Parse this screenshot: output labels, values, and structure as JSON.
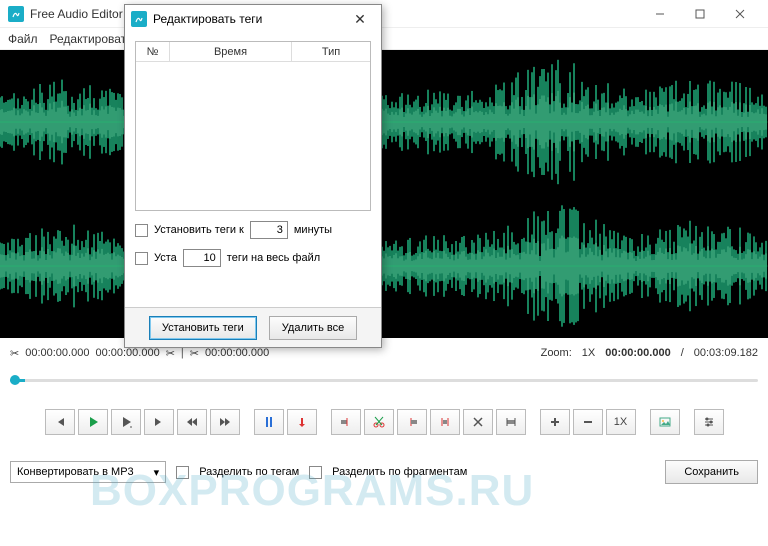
{
  "title": "Free Audio Editor",
  "menu": {
    "file": "Файл",
    "edit": "Редактировать"
  },
  "timeline": {
    "t1": "00:00:00.000",
    "t2": "00:00:00.000",
    "t3": "00:00:00.000",
    "zoom_label": "Zoom:",
    "zoom_val": "1X",
    "pos": "00:00:00.000",
    "dur": "00:03:09.182"
  },
  "toolbar": {
    "rate": "1X"
  },
  "bottom": {
    "convert": "Конвертировать в MP3",
    "split_tags": "Разделить по тегам",
    "split_frag": "Разделить по фрагментам",
    "save": "Сохранить"
  },
  "dialog": {
    "title": "Редактировать теги",
    "col_num": "№",
    "col_time": "Время",
    "col_type": "Тип",
    "row1_a": "Установить теги к",
    "row1_val": "3",
    "row1_b": "минуты",
    "row2_a": "Уста",
    "row2_val": "10",
    "row2_b": "теги на весь файл",
    "set": "Установить теги",
    "del": "Удалить все"
  },
  "watermark": "BOXPROGRAMS.RU"
}
